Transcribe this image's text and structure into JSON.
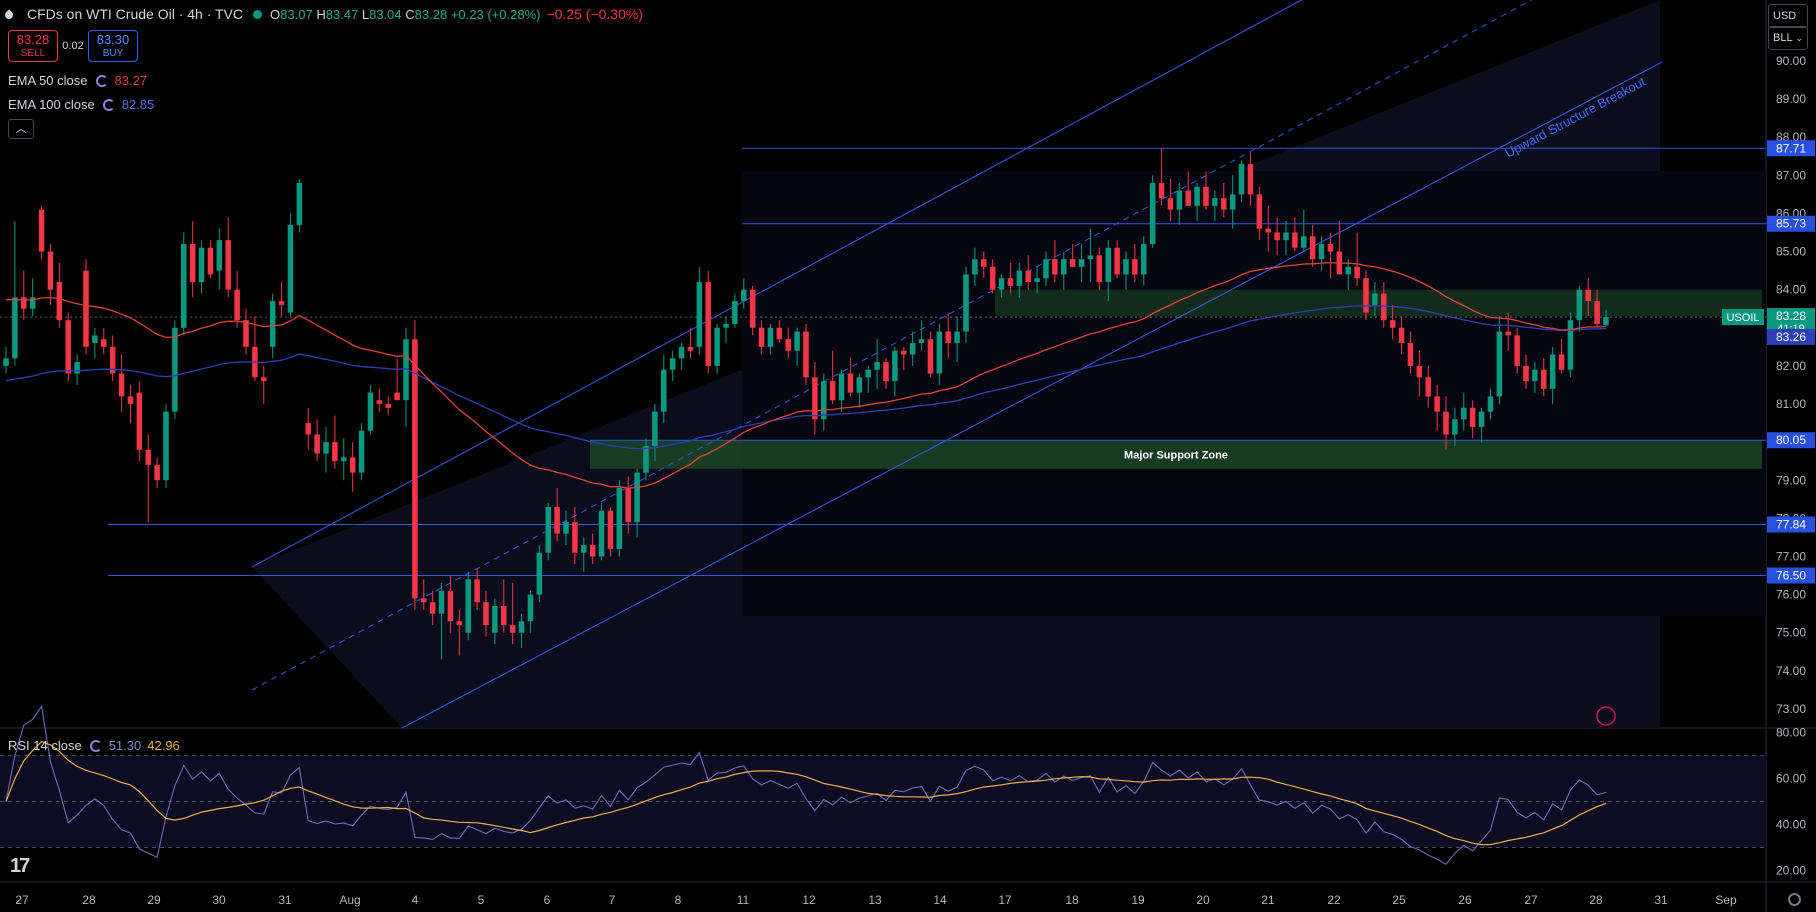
{
  "header": {
    "symbol": "CFDs on WTI Crude Oil · 4h · TVC",
    "open": "83.07",
    "high": "83.47",
    "low": "83.04",
    "close": "83.28",
    "change": "+0.23 (+0.28%)",
    "change2": "−0.25 (−0.30%)"
  },
  "trade": {
    "sell_price": "83.28",
    "sell_label": "SELL",
    "spread": "0.02",
    "buy_price": "83.30",
    "buy_label": "BUY"
  },
  "indicators": {
    "ema50_label": "EMA 50 close",
    "ema50_value": "83.27",
    "ema100_label": "EMA 100 close",
    "ema100_value": "82.85",
    "rsi_label": "RSI 14 close",
    "rsi_value": "51.30",
    "rsi_ma_value": "42.96"
  },
  "top_right": {
    "currency": "USD",
    "unit": "BLL"
  },
  "colors": {
    "up": "#089981",
    "down": "#f23645",
    "ema50": "#e0423a",
    "ema100": "#2d3fb5",
    "rsi": "#6e6ab8",
    "rsi_ma": "#e4b04a",
    "lines": "#3355dd",
    "zone": "#1d4d26"
  },
  "chart_data": {
    "type": "candlestick",
    "title": "CFDs on WTI Crude Oil · 4h · TVC",
    "y_axis": {
      "ticks": [
        "90.00",
        "89.00",
        "88.00",
        "87.00",
        "86.00",
        "85.00",
        "84.00",
        "83.00",
        "82.00",
        "81.00",
        "80.00",
        "79.00",
        "78.00",
        "77.00",
        "76.00",
        "75.00",
        "74.00",
        "73.00"
      ],
      "ylim": [
        72.5,
        91.6
      ]
    },
    "x_axis": {
      "ticks": [
        "27",
        "28",
        "29",
        "30",
        "31",
        "Aug",
        "4",
        "5",
        "6",
        "7",
        "8",
        "11",
        "12",
        "13",
        "14",
        "17",
        "18",
        "19",
        "20",
        "21",
        "22",
        "25",
        "26",
        "27",
        "28",
        "31",
        "Sep"
      ]
    },
    "price_labels": [
      {
        "value": 87.71,
        "text": "87.71"
      },
      {
        "value": 85.73,
        "text": "85.73"
      },
      {
        "value": 80.05,
        "text": "80.05"
      },
      {
        "value": 77.84,
        "text": "77.84"
      },
      {
        "value": 76.5,
        "text": "76.50"
      }
    ],
    "current_price": {
      "value": 83.28,
      "symbol": "USOIL",
      "price": "83.28",
      "countdown": "41:19"
    },
    "ema100_last": {
      "value": 83.26,
      "text": "83.26"
    },
    "zones": [
      {
        "label": "Major Support Zone",
        "low": 79.3,
        "high": 80.05
      },
      {
        "label": "",
        "low": 83.3,
        "high": 84.0
      }
    ],
    "trendline_label": "Upward Structure Breakout",
    "candles": [
      [
        82.0,
        82.5,
        81.8,
        82.2
      ],
      [
        82.2,
        85.8,
        82.0,
        83.8
      ],
      [
        83.8,
        84.5,
        83.2,
        83.5
      ],
      [
        83.5,
        84.3,
        83.3,
        83.8
      ],
      [
        86.1,
        86.2,
        84.8,
        85.0
      ],
      [
        85.0,
        85.2,
        83.6,
        84.0
      ],
      [
        84.2,
        84.7,
        83.0,
        83.2
      ],
      [
        83.2,
        83.4,
        81.6,
        81.8
      ],
      [
        81.8,
        82.3,
        81.5,
        82.1
      ],
      [
        84.5,
        84.8,
        82.3,
        82.5
      ],
      [
        82.6,
        83.0,
        82.2,
        82.8
      ],
      [
        82.7,
        83.0,
        82.3,
        82.5
      ],
      [
        82.5,
        82.8,
        81.6,
        81.8
      ],
      [
        81.8,
        82.3,
        80.8,
        81.2
      ],
      [
        81.2,
        81.5,
        80.5,
        81.0
      ],
      [
        81.3,
        81.6,
        79.5,
        79.8
      ],
      [
        79.8,
        80.2,
        77.9,
        79.4
      ],
      [
        79.4,
        79.6,
        78.8,
        79.0
      ],
      [
        79.0,
        81.0,
        78.8,
        80.8
      ],
      [
        80.8,
        83.2,
        80.6,
        83.0
      ],
      [
        83.0,
        85.5,
        82.8,
        85.2
      ],
      [
        85.2,
        85.8,
        83.8,
        84.2
      ],
      [
        84.2,
        85.3,
        83.9,
        85.1
      ],
      [
        85.1,
        85.3,
        84.3,
        84.4
      ],
      [
        84.5,
        85.6,
        84.0,
        85.3
      ],
      [
        85.3,
        85.9,
        83.8,
        84.0
      ],
      [
        84.0,
        84.5,
        83.0,
        83.2
      ],
      [
        83.2,
        83.5,
        82.3,
        82.5
      ],
      [
        82.5,
        83.3,
        81.6,
        81.7
      ],
      [
        81.7,
        82.0,
        81.0,
        81.6
      ],
      [
        82.5,
        83.9,
        82.2,
        83.7
      ],
      [
        83.7,
        84.2,
        83.3,
        83.6
      ],
      [
        83.4,
        86.0,
        83.3,
        85.7
      ],
      [
        85.7,
        86.9,
        85.5,
        86.8
      ],
      [
        80.5,
        80.9,
        79.8,
        80.2
      ],
      [
        80.2,
        80.6,
        79.5,
        79.7
      ],
      [
        79.7,
        80.4,
        79.2,
        80.0
      ],
      [
        80.0,
        80.7,
        79.3,
        79.5
      ],
      [
        79.5,
        80.1,
        79.0,
        79.6
      ],
      [
        79.6,
        80.0,
        78.7,
        79.2
      ],
      [
        79.2,
        80.5,
        79.0,
        80.3
      ],
      [
        80.3,
        81.5,
        80.2,
        81.3
      ],
      [
        81.1,
        81.4,
        80.8,
        81.0
      ],
      [
        81.0,
        81.2,
        80.7,
        80.9
      ],
      [
        81.3,
        82.2,
        81.1,
        81.1
      ],
      [
        81.1,
        83.0,
        80.4,
        82.7
      ],
      [
        82.7,
        83.2,
        75.6,
        75.9
      ],
      [
        75.9,
        76.4,
        75.6,
        75.8
      ],
      [
        75.8,
        76.1,
        75.2,
        75.5
      ],
      [
        75.5,
        76.3,
        74.3,
        76.1
      ],
      [
        76.1,
        76.5,
        75.0,
        75.3
      ],
      [
        75.3,
        75.6,
        74.4,
        75.2
      ],
      [
        75.0,
        76.6,
        74.8,
        76.4
      ],
      [
        76.4,
        76.7,
        75.6,
        75.8
      ],
      [
        75.8,
        76.1,
        74.9,
        75.2
      ],
      [
        75.0,
        75.9,
        74.7,
        75.7
      ],
      [
        75.7,
        76.4,
        75.0,
        75.2
      ],
      [
        75.2,
        76.3,
        74.7,
        75.0
      ],
      [
        75.0,
        75.5,
        74.6,
        75.3
      ],
      [
        75.3,
        76.1,
        75.0,
        76.0
      ],
      [
        76.0,
        77.3,
        75.8,
        77.1
      ],
      [
        77.1,
        78.4,
        76.9,
        78.3
      ],
      [
        78.3,
        78.8,
        77.4,
        77.6
      ],
      [
        77.6,
        78.2,
        77.3,
        77.9
      ],
      [
        77.9,
        78.3,
        76.8,
        77.1
      ],
      [
        77.1,
        77.5,
        76.6,
        77.3
      ],
      [
        77.3,
        77.6,
        76.8,
        77.0
      ],
      [
        77.0,
        78.4,
        76.9,
        78.2
      ],
      [
        78.2,
        78.3,
        77.0,
        77.2
      ],
      [
        77.2,
        79.0,
        77.0,
        78.8
      ],
      [
        78.8,
        79.1,
        77.6,
        77.9
      ],
      [
        77.9,
        79.3,
        77.5,
        79.2
      ],
      [
        79.2,
        80.1,
        79.0,
        79.9
      ],
      [
        79.9,
        81.0,
        79.5,
        80.8
      ],
      [
        80.8,
        82.3,
        80.5,
        81.9
      ],
      [
        81.9,
        82.4,
        81.6,
        82.2
      ],
      [
        82.2,
        82.6,
        81.9,
        82.5
      ],
      [
        82.5,
        83.0,
        82.2,
        82.4
      ],
      [
        82.5,
        84.6,
        82.3,
        84.2
      ],
      [
        84.2,
        84.5,
        81.8,
        82.0
      ],
      [
        82.0,
        83.1,
        81.8,
        83.0
      ],
      [
        83.0,
        83.3,
        82.6,
        83.1
      ],
      [
        83.1,
        83.9,
        83.0,
        83.7
      ],
      [
        83.7,
        84.3,
        83.5,
        84.0
      ],
      [
        84.0,
        84.1,
        82.8,
        83.0
      ],
      [
        83.0,
        83.2,
        82.3,
        82.5
      ],
      [
        82.5,
        83.1,
        82.3,
        83.0
      ],
      [
        83.0,
        83.2,
        82.6,
        82.7
      ],
      [
        82.7,
        83.0,
        82.2,
        82.4
      ],
      [
        82.4,
        83.0,
        82.0,
        82.9
      ],
      [
        82.9,
        83.1,
        81.5,
        81.7
      ],
      [
        81.7,
        82.1,
        80.2,
        80.6
      ],
      [
        80.6,
        81.8,
        80.3,
        81.6
      ],
      [
        81.6,
        82.4,
        81.0,
        81.1
      ],
      [
        81.1,
        81.9,
        80.8,
        81.8
      ],
      [
        81.8,
        82.2,
        81.2,
        81.3
      ],
      [
        81.3,
        81.8,
        80.9,
        81.7
      ],
      [
        81.7,
        82.0,
        81.3,
        81.9
      ],
      [
        81.9,
        82.7,
        81.4,
        82.1
      ],
      [
        82.1,
        82.2,
        81.4,
        81.6
      ],
      [
        81.6,
        82.5,
        81.2,
        82.4
      ],
      [
        82.4,
        82.5,
        81.9,
        82.3
      ],
      [
        82.3,
        82.9,
        82.0,
        82.6
      ],
      [
        82.6,
        83.2,
        82.4,
        82.7
      ],
      [
        82.7,
        82.9,
        81.7,
        81.8
      ],
      [
        81.8,
        83.1,
        81.5,
        82.9
      ],
      [
        82.9,
        83.4,
        82.2,
        82.6
      ],
      [
        82.6,
        83.3,
        82.1,
        82.9
      ],
      [
        82.9,
        84.6,
        82.6,
        84.4
      ],
      [
        84.4,
        85.1,
        84.1,
        84.8
      ],
      [
        84.8,
        85.0,
        84.3,
        84.6
      ],
      [
        84.6,
        84.8,
        83.9,
        84.0
      ],
      [
        84.0,
        84.4,
        83.8,
        84.3
      ],
      [
        84.3,
        84.7,
        83.9,
        84.1
      ],
      [
        84.1,
        84.7,
        83.8,
        84.5
      ],
      [
        84.5,
        84.9,
        84.0,
        84.2
      ],
      [
        84.2,
        84.6,
        83.9,
        84.3
      ],
      [
        84.3,
        85.0,
        84.1,
        84.8
      ],
      [
        84.8,
        85.3,
        84.2,
        84.4
      ],
      [
        84.4,
        85.0,
        84.0,
        84.8
      ],
      [
        84.8,
        85.2,
        84.6,
        84.6
      ],
      [
        84.6,
        85.2,
        84.2,
        84.8
      ],
      [
        84.8,
        85.6,
        84.2,
        84.9
      ],
      [
        84.9,
        85.1,
        84.0,
        84.2
      ],
      [
        84.2,
        85.3,
        83.7,
        85.1
      ],
      [
        85.1,
        85.3,
        84.3,
        84.4
      ],
      [
        84.4,
        85.0,
        84.0,
        84.8
      ],
      [
        84.8,
        85.2,
        84.2,
        84.4
      ],
      [
        84.4,
        85.4,
        84.1,
        85.2
      ],
      [
        85.2,
        87.0,
        85.1,
        86.8
      ],
      [
        86.8,
        87.7,
        86.2,
        86.4
      ],
      [
        86.4,
        86.9,
        85.8,
        86.1
      ],
      [
        86.1,
        86.8,
        85.7,
        86.6
      ],
      [
        86.6,
        87.1,
        86.2,
        86.2
      ],
      [
        86.2,
        86.8,
        85.8,
        86.7
      ],
      [
        86.7,
        87.1,
        86.1,
        86.2
      ],
      [
        86.2,
        86.6,
        85.8,
        86.4
      ],
      [
        86.4,
        86.8,
        85.9,
        86.1
      ],
      [
        86.1,
        87.0,
        85.6,
        86.5
      ],
      [
        86.5,
        87.4,
        86.3,
        87.3
      ],
      [
        87.3,
        87.6,
        86.2,
        86.5
      ],
      [
        86.5,
        86.7,
        85.3,
        85.6
      ],
      [
        85.6,
        86.2,
        85.0,
        85.5
      ],
      [
        85.5,
        85.9,
        84.9,
        85.3
      ],
      [
        85.3,
        85.8,
        84.9,
        85.5
      ],
      [
        85.5,
        85.9,
        85.0,
        85.1
      ],
      [
        85.1,
        86.1,
        85.0,
        85.4
      ],
      [
        85.4,
        85.7,
        84.6,
        84.8
      ],
      [
        84.8,
        85.4,
        84.5,
        85.2
      ],
      [
        85.2,
        85.5,
        84.3,
        85.0
      ],
      [
        85.0,
        85.8,
        84.4,
        84.4
      ],
      [
        84.4,
        84.8,
        84.0,
        84.6
      ],
      [
        84.6,
        85.5,
        84.1,
        84.3
      ],
      [
        84.3,
        84.5,
        83.2,
        83.4
      ],
      [
        83.6,
        84.2,
        83.3,
        83.9
      ],
      [
        83.9,
        84.2,
        83.0,
        83.2
      ],
      [
        83.2,
        83.6,
        82.7,
        83.0
      ],
      [
        83.0,
        83.3,
        82.3,
        82.6
      ],
      [
        82.6,
        82.9,
        81.8,
        82.0
      ],
      [
        82.0,
        82.4,
        81.2,
        81.7
      ],
      [
        81.7,
        82.0,
        80.9,
        81.2
      ],
      [
        81.2,
        81.5,
        80.3,
        80.8
      ],
      [
        80.8,
        81.2,
        79.8,
        80.2
      ],
      [
        80.2,
        80.9,
        79.9,
        80.6
      ],
      [
        80.6,
        81.3,
        80.3,
        80.9
      ],
      [
        80.9,
        81.1,
        80.1,
        80.4
      ],
      [
        80.4,
        80.9,
        80.0,
        80.8
      ],
      [
        80.8,
        81.4,
        80.6,
        81.2
      ],
      [
        81.2,
        83.3,
        81.0,
        82.9
      ],
      [
        82.9,
        83.4,
        82.4,
        82.8
      ],
      [
        82.8,
        83.0,
        81.8,
        82.0
      ],
      [
        82.0,
        82.3,
        81.4,
        81.6
      ],
      [
        81.6,
        82.1,
        81.3,
        81.9
      ],
      [
        81.9,
        82.2,
        81.2,
        81.4
      ],
      [
        81.4,
        82.5,
        81.0,
        82.3
      ],
      [
        82.3,
        82.7,
        81.8,
        81.9
      ],
      [
        81.9,
        83.4,
        81.7,
        83.2
      ],
      [
        83.2,
        84.1,
        82.9,
        84.0
      ],
      [
        84.0,
        84.3,
        83.3,
        83.7
      ],
      [
        83.7,
        84.0,
        83.0,
        83.1
      ],
      [
        83.07,
        83.47,
        83.04,
        83.28
      ]
    ],
    "rsi_axis": {
      "ticks": [
        "80.00",
        "60.00",
        "40.00",
        "20.00"
      ],
      "ylim": [
        15,
        82
      ]
    }
  }
}
